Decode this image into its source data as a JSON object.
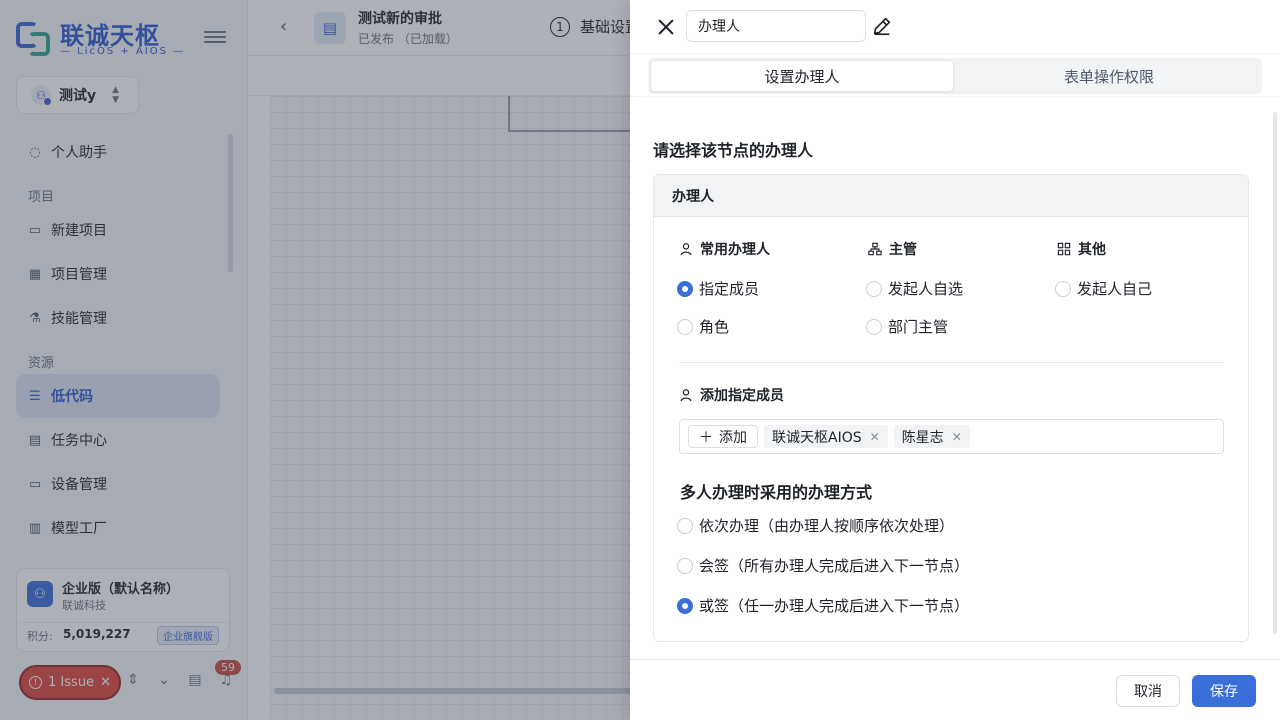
{
  "sidebar": {
    "brand_name": "联诚天枢",
    "brand_sub": "— LicOS + AIOS —",
    "space_selector": "测试y",
    "nav": [
      {
        "type": "item",
        "label": "个人助手",
        "icon": "chat-icon",
        "active": false
      },
      {
        "type": "section",
        "label": "项目"
      },
      {
        "type": "item",
        "label": "新建项目",
        "icon": "monitor-icon",
        "active": false
      },
      {
        "type": "item",
        "label": "项目管理",
        "icon": "grid-icon",
        "active": false
      },
      {
        "type": "item",
        "label": "技能管理",
        "icon": "flask-icon",
        "active": false
      },
      {
        "type": "section",
        "label": "资源"
      },
      {
        "type": "item",
        "label": "低代码",
        "icon": "list-icon",
        "active": true
      },
      {
        "type": "item",
        "label": "任务中心",
        "icon": "calendar-icon",
        "active": false
      },
      {
        "type": "item",
        "label": "设备管理",
        "icon": "laptop-icon",
        "active": false
      },
      {
        "type": "item",
        "label": "模型工厂",
        "icon": "factory-icon",
        "active": false
      }
    ],
    "org": {
      "name": "企业版（默认名称）",
      "company": "联诚科技",
      "points_label": "积分:",
      "points_value": "5,019,227",
      "plan_badge": "企业旗舰版"
    },
    "issue_button": "1 Issue",
    "notification_count": "59"
  },
  "main": {
    "app_name": "测试新的审批",
    "app_status": "已发布 （已加载）",
    "step_number": "1",
    "step_label": "基础设置"
  },
  "drawer": {
    "node_name": "办理人",
    "tabs": [
      {
        "label": "设置办理人",
        "active": true
      },
      {
        "label": "表单操作权限",
        "active": false
      }
    ],
    "section_title": "请选择该节点的办理人",
    "card_title": "办理人",
    "groups": [
      {
        "title": "常用办理人",
        "icon": "user-icon",
        "options": [
          {
            "label": "指定成员",
            "checked": true
          },
          {
            "label": "角色",
            "checked": false
          }
        ]
      },
      {
        "title": "主管",
        "icon": "org-chart-icon",
        "options": [
          {
            "label": "发起人自选",
            "checked": false
          },
          {
            "label": "部门主管",
            "checked": false
          }
        ]
      },
      {
        "title": "其他",
        "icon": "grid-icon",
        "options": [
          {
            "label": "发起人自己",
            "checked": false
          }
        ]
      }
    ],
    "add_member_title": "添加指定成员",
    "add_button": "添加",
    "members": [
      "联诚天枢AIOS",
      "陈星志"
    ],
    "mode_title": "多人办理时采用的办理方式",
    "modes": [
      {
        "label": "依次办理（由办理人按顺序依次处理）",
        "checked": false
      },
      {
        "label": "会签（所有办理人完成后进入下一节点）",
        "checked": false
      },
      {
        "label": "或签（任一办理人完成后进入下一节点）",
        "checked": true
      }
    ],
    "cancel_button": "取消",
    "save_button": "保存"
  }
}
